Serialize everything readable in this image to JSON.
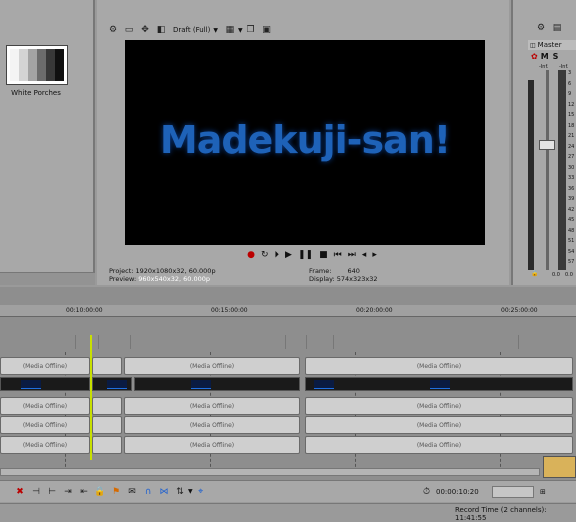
{
  "media_panel": {
    "thumbnail_caption": "White Porches"
  },
  "preview_toolbar": {
    "quality_label": "Draft (Full)",
    "icons": [
      "gear-icon",
      "external-monitor-icon",
      "split-screen-icon",
      "overlay-icon",
      "grid-icon",
      "copy-snapshot-icon",
      "save-snapshot-icon"
    ]
  },
  "preview": {
    "title_text": "Madekuji-san!",
    "title_color": "#1e62b8",
    "transport_icons": [
      "record",
      "loop",
      "play-from-start",
      "play",
      "pause",
      "stop",
      "prev-frame",
      "next-frame",
      "prev-marker",
      "next-marker"
    ]
  },
  "preview_info": {
    "project_label": "Project:",
    "project_value": "1920x1080x32, 60.000p",
    "preview_label": "Preview:",
    "preview_value": "960x540x32, 60.000p",
    "frame_label": "Frame:",
    "frame_value": "640",
    "display_label": "Display:",
    "display_value": "574x323x32"
  },
  "master_bus": {
    "title": "Master",
    "buttons": [
      "M",
      "S"
    ],
    "scale_top_left": "-Inf.",
    "scale_top_right": "-Inf.",
    "scale": [
      "3",
      "6",
      "9",
      "12",
      "15",
      "18",
      "21",
      "24",
      "27",
      "30",
      "33",
      "36",
      "39",
      "42",
      "45",
      "48",
      "51",
      "54",
      "57"
    ],
    "bottom_left": "0.0",
    "bottom_right": "0.0"
  },
  "timeline": {
    "ruler_labels": [
      "00:10:00:00",
      "00:15:00:00",
      "00:20:00:00",
      "00:25:00:00"
    ],
    "offline_label": "(Media Offline)"
  },
  "bottom_toolbar": {
    "icons": [
      "delete-icon",
      "trim-icon",
      "split-icon",
      "marker-icon",
      "lock-icon",
      "region-icon",
      "snap-icon",
      "auto-ripple-icon",
      "edit-tool-icon",
      "select-icon"
    ],
    "time_value": "00:00:10:20"
  },
  "status_bar": {
    "record_time": "Record Time (2 channels): 11:41:55"
  }
}
